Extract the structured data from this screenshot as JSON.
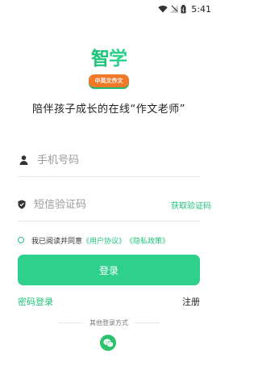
{
  "status_bar": {
    "time": "5:41",
    "icons": [
      "wifi-icon",
      "signal-icon",
      "battery-icon"
    ]
  },
  "logo": {
    "title_part1": "智",
    "title_part2": "学",
    "badge": "中英文作文"
  },
  "slogan": "陪伴孩子成长的在线“作文老师”",
  "form": {
    "phone": {
      "placeholder": "手机号码",
      "value": "",
      "icon": "person-icon"
    },
    "code": {
      "placeholder": "短信验证码",
      "value": "",
      "icon": "shield-icon"
    },
    "get_code_label": "获取验证码"
  },
  "agreement": {
    "prefix": "我已阅读并同意",
    "user_agreement": "《用户协议》",
    "privacy_policy": "《隐私政策》"
  },
  "login_button": "登录",
  "password_login": "密码登录",
  "register": "注册",
  "other_login_label": "其他登录方式",
  "colors": {
    "accent": "#1fc37a",
    "button": "#2fd08c",
    "badge": "#f07a2a",
    "wechat": "#2bc26e"
  }
}
